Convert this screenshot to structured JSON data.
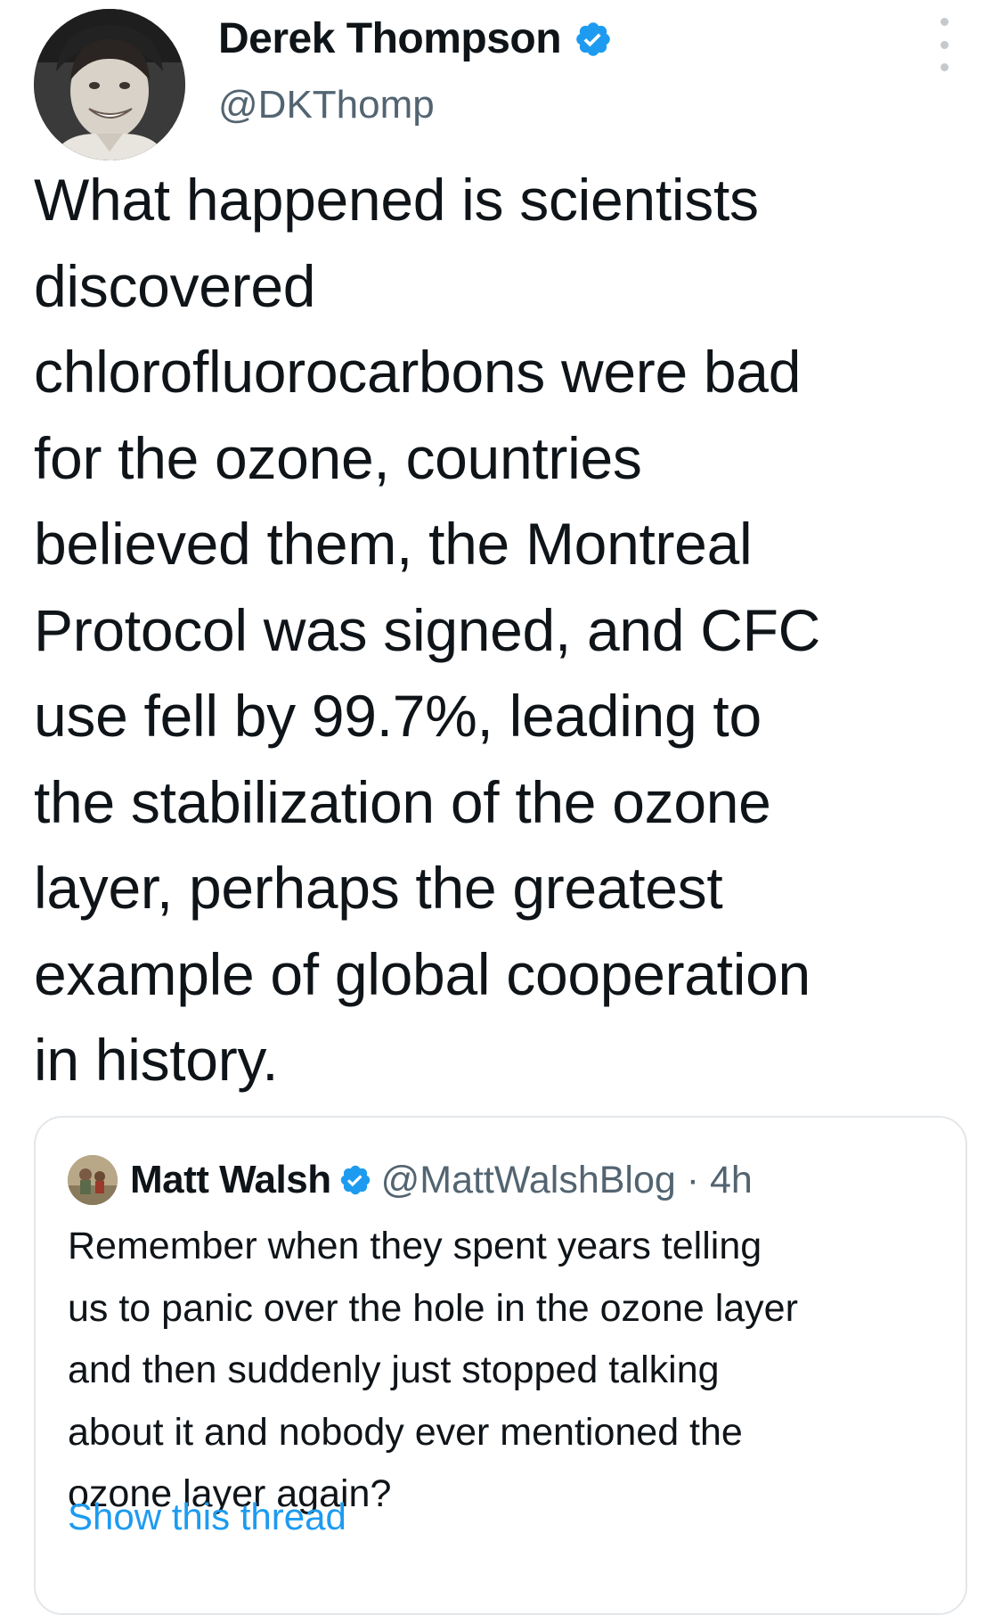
{
  "tweet": {
    "author": {
      "display_name": "Derek Thompson",
      "handle": "@DKThomp",
      "verified": true
    },
    "body_lines": [
      "What happened is scientists",
      "discovered",
      "chlorofluorocarbons were bad",
      "for the ozone, countries",
      "believed them, the Montreal",
      "Protocol was signed, and CFC",
      "use fell by 99.7%, leading to",
      "the stabilization of the ozone",
      "layer, perhaps the greatest",
      "example of global cooperation",
      "in history."
    ]
  },
  "quoted_tweet": {
    "author": {
      "display_name": "Matt Walsh",
      "handle_and_time": "@MattWalshBlog · 4h",
      "verified": true
    },
    "body_lines": [
      "Remember when they spent years telling",
      "us to panic over the hole in the ozone layer",
      "and then suddenly just stopped talking",
      "about it and nobody ever mentioned the",
      "ozone layer again?"
    ],
    "show_thread_label": "Show this thread"
  },
  "icons": {
    "verified": "verified-badge-icon",
    "more": "more-options-icon"
  },
  "colors": {
    "verified_blue": "#1d9bf0",
    "link_blue": "#1d9bf0",
    "secondary_text": "#536471",
    "primary_text": "#0f1419"
  }
}
